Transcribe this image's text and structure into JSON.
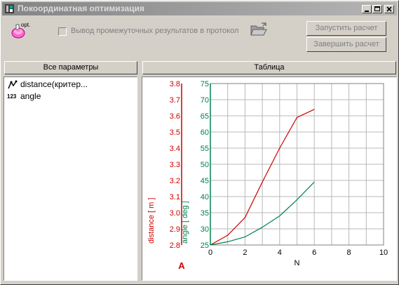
{
  "window": {
    "title": "Покоординатная оптимизация",
    "buttons": [
      "minimize",
      "maximize",
      "close"
    ]
  },
  "toolbar": {
    "opt_icon_label": "opt.",
    "checkbox_label": "Вывод промежуточных результатов в протокол",
    "checkbox_checked": false,
    "start_button": "Запустить расчет",
    "finish_button": "Завершить расчет"
  },
  "left_panel": {
    "header": "Все параметры",
    "items": [
      {
        "label": "distance(критер...",
        "icon": "criterion-icon"
      },
      {
        "label": "angle",
        "icon": "numeric-icon",
        "icon_text": "123"
      }
    ]
  },
  "right_panel": {
    "header": "Таблица",
    "axis_marker": "A"
  },
  "chart_data": {
    "type": "line",
    "xlabel": "N",
    "xlim": [
      0,
      10
    ],
    "x_ticks": [
      0,
      2,
      4,
      6,
      8,
      10
    ],
    "grid": true,
    "axes": [
      {
        "label": "distance",
        "unit": "m",
        "color": "#cc0000",
        "ylim": [
          2.8,
          3.8
        ],
        "ticks": [
          "2.8",
          "2.9",
          "3.0",
          "3.1",
          "3.2",
          "3.3",
          "3.4",
          "3.5",
          "3.6",
          "3.7",
          "3.8"
        ]
      },
      {
        "label": "angle",
        "unit": "deg",
        "color": "#008050",
        "ylim": [
          25,
          75
        ],
        "ticks": [
          "25",
          "30",
          "35",
          "40",
          "45",
          "50",
          "55",
          "60",
          "65",
          "70",
          "75"
        ]
      }
    ],
    "series": [
      {
        "name": "distance",
        "axis": 0,
        "color": "#cc0000",
        "x": [
          0,
          1,
          2,
          3,
          4,
          5,
          6
        ],
        "values": [
          2.8,
          2.86,
          2.97,
          3.19,
          3.4,
          3.59,
          3.64
        ]
      },
      {
        "name": "angle",
        "axis": 1,
        "color": "#008050",
        "x": [
          0,
          1,
          2,
          3,
          4,
          5,
          6
        ],
        "values": [
          25.0,
          26.0,
          27.5,
          30.5,
          34.0,
          39.0,
          44.5
        ]
      }
    ]
  }
}
